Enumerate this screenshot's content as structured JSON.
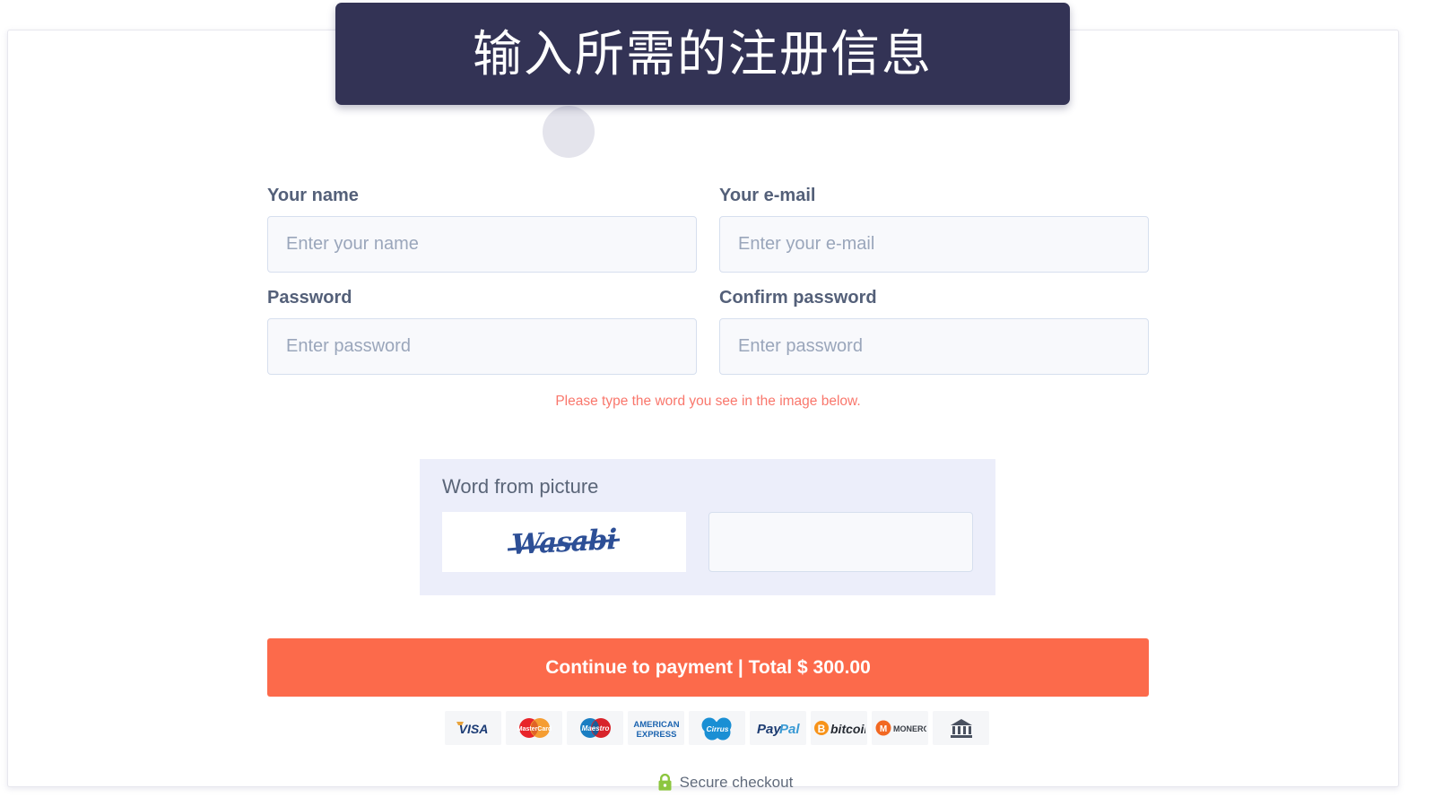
{
  "banner": {
    "title": "输入所需的注册信息",
    "background_color": "#333355",
    "text_color": "#ffffff"
  },
  "form": {
    "fields": [
      {
        "label": "Your name",
        "placeholder": "Enter your name",
        "value": "",
        "name": "name"
      },
      {
        "label": "Your e-mail",
        "placeholder": "Enter your e-mail",
        "value": "",
        "name": "email"
      },
      {
        "label": "Password",
        "placeholder": "Enter password",
        "value": "",
        "name": "password"
      },
      {
        "label": "Confirm password",
        "placeholder": "Enter password",
        "value": "",
        "name": "confirm-password"
      }
    ]
  },
  "captcha": {
    "warning": "Please type the word you see in the image below.",
    "warning_color": "#f9776c",
    "title": "Word from picture",
    "image_word": "Wasabi",
    "answer_value": "",
    "answer_placeholder": "",
    "panel_color": "#eceefa"
  },
  "submit": {
    "label": "Continue to payment | Total $ 300.00",
    "background_color": "#fc6a4b",
    "total": "$ 300.00"
  },
  "payment_methods": [
    {
      "name": "visa",
      "label": "VISA"
    },
    {
      "name": "mastercard",
      "label": "MasterCard"
    },
    {
      "name": "maestro",
      "label": "Maestro"
    },
    {
      "name": "american-express",
      "label": "AMERICAN EXPRESS"
    },
    {
      "name": "cirrus",
      "label": "Cirrus"
    },
    {
      "name": "paypal",
      "label": "PayPal"
    },
    {
      "name": "bitcoin",
      "label": "bitcoin"
    },
    {
      "name": "monero",
      "label": "MONERO"
    },
    {
      "name": "bank-transfer",
      "label": ""
    }
  ],
  "footer": {
    "secure_label": "Secure checkout",
    "lock_icon": "lock-icon",
    "lock_color": "#8cc63f"
  }
}
